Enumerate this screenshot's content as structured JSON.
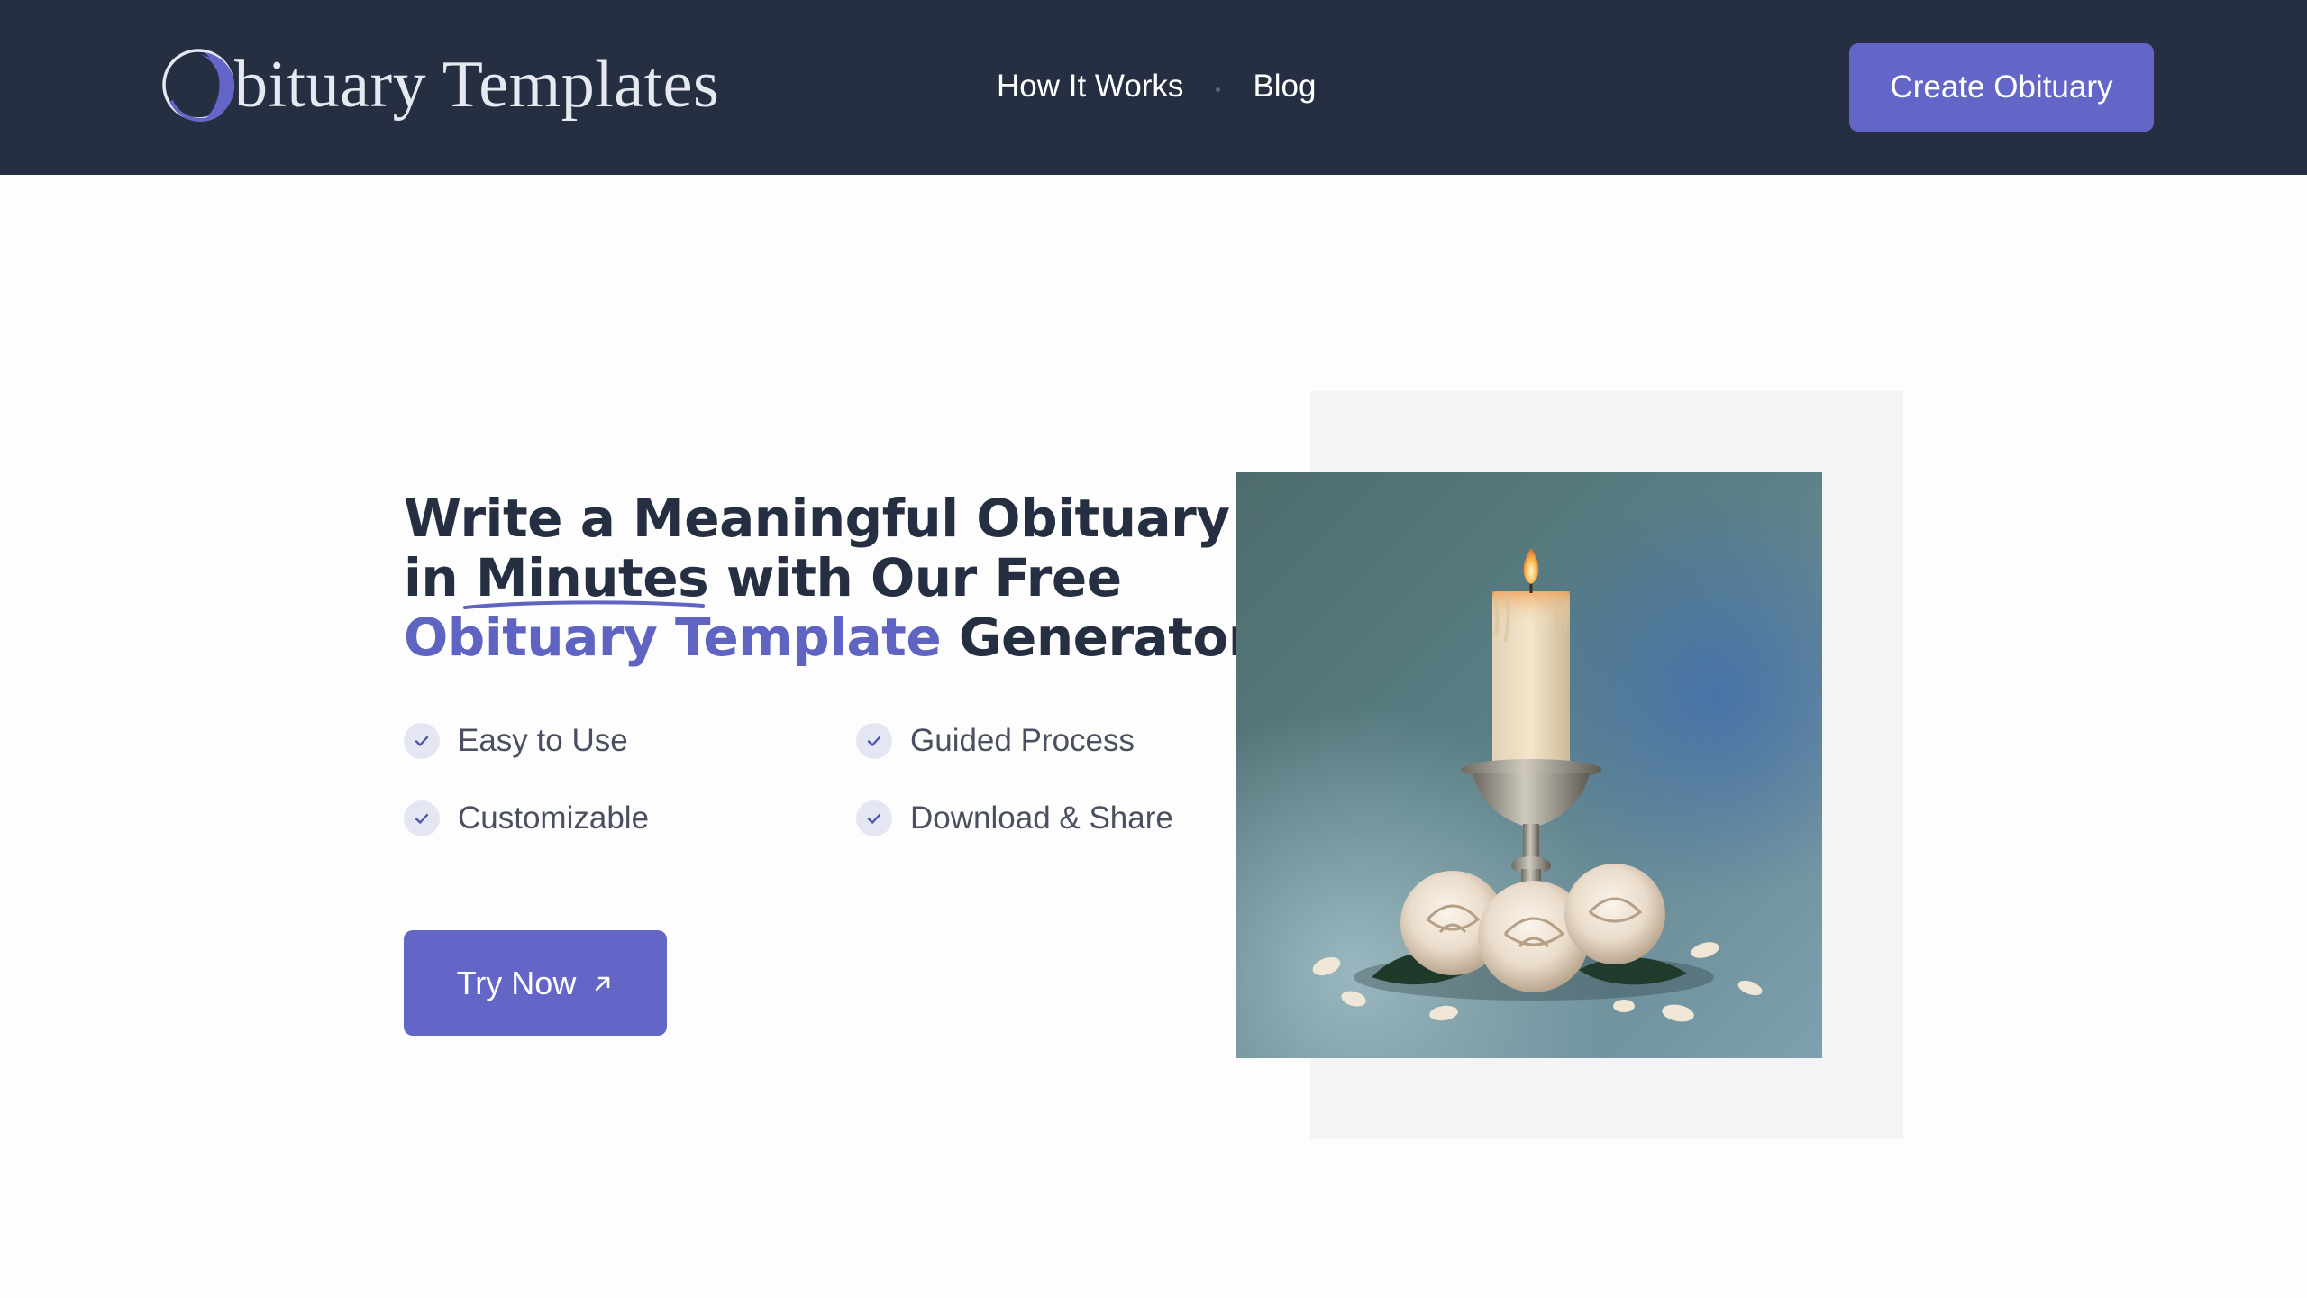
{
  "header": {
    "logo_text": "bituary Templates",
    "nav": [
      {
        "label": "How It Works"
      },
      {
        "label": "Blog"
      }
    ],
    "cta_label": "Create Obituary"
  },
  "hero": {
    "headline": {
      "part1": "Write a Meaningful Obituary in ",
      "underlined": "Minutes",
      "part2": " with Our Free ",
      "accent": "Obituary Template",
      "part3": " Generator"
    },
    "features": [
      {
        "label": "Easy to Use"
      },
      {
        "label": "Guided Process"
      },
      {
        "label": "Customizable"
      },
      {
        "label": "Download & Share"
      }
    ],
    "button_label": "Try Now"
  },
  "colors": {
    "header_bg": "#262f42",
    "accent": "#6366c7",
    "heading": "#262f42",
    "body_text": "#4a5060"
  },
  "icons": {
    "logo": "crescent-circle-logo",
    "feature_check": "check-icon",
    "button_arrow": "arrow-up-right-icon",
    "hero_image": "candle-with-roses-image"
  }
}
